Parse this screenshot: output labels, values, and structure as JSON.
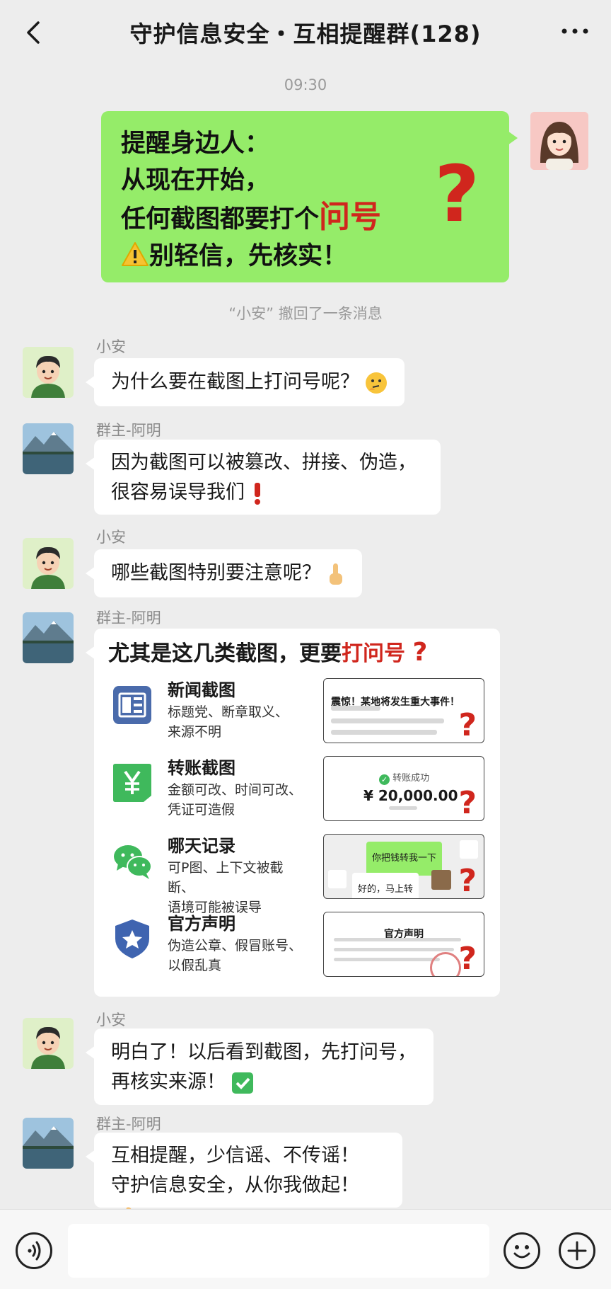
{
  "header": {
    "title": "守护信息安全・互相提醒群(128)"
  },
  "timestamp": "09:30",
  "my_message": {
    "line1": "提醒身边人：",
    "line2": "从现在开始，",
    "line3_prefix": "任何截图都要打个",
    "line3_red": "问号",
    "big_mark": "?",
    "line4": "别轻信，先核实！"
  },
  "recall_notice": "“小安” 撤回了一条消息",
  "messages": [
    {
      "sender": "小安",
      "text": "为什么要在截图上打问号呢？"
    },
    {
      "sender": "群主-阿明",
      "line1": "因为截图可以被篡改、拼接、伪造，",
      "line2": "很容易误导我们"
    },
    {
      "sender": "小安",
      "text": "哪些截图特别要注意呢？"
    },
    {
      "sender": "群主-阿明"
    },
    {
      "sender": "小安",
      "line1": "明白了！以后看到截图，先打问号，",
      "line2": "再核实来源！"
    },
    {
      "sender": "群主-阿明",
      "line1": "互相提醒，少信谣、不传谣！",
      "line2": "守护信息安全，从你我做起！"
    }
  ],
  "card": {
    "title_prefix": "尤其是这几类截图，更要",
    "title_red": "打问号",
    "categories": [
      {
        "name": "新闻截图",
        "desc1": "标题党、断章取义、",
        "desc2": "来源不明",
        "thumb_text": "震惊！某地将发生重大事件！",
        "icon": "news-icon"
      },
      {
        "name": "转账截图",
        "desc1": "金额可改、时间可改、",
        "desc2": "凭证可造假",
        "thumb_status": "转账成功",
        "thumb_amount": "¥ 20,000.00",
        "icon": "yen-icon"
      },
      {
        "name": "哪天记录",
        "desc1": "可P图、上下文被截断、",
        "desc2": "语境可能被误导",
        "thumb_msg1": "你把钱转我一下",
        "thumb_msg2": "好的，马上转",
        "icon": "wechat-icon"
      },
      {
        "name": "官方声明",
        "desc1": "伪造公章、假冒账号、",
        "desc2": "以假乱真",
        "thumb_title": "官方声明",
        "icon": "shield-star-icon"
      }
    ]
  },
  "colors": {
    "background": "#ededed",
    "green_bubble": "#95ec69",
    "accent_red": "#d0261d"
  }
}
